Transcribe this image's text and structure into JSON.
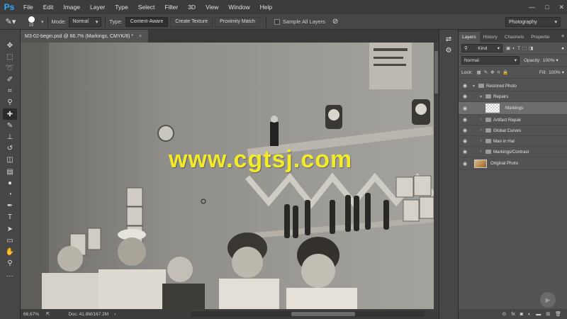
{
  "app": {
    "logo": "Ps"
  },
  "menu": [
    "File",
    "Edit",
    "Image",
    "Layer",
    "Type",
    "Select",
    "Filter",
    "3D",
    "View",
    "Window",
    "Help"
  ],
  "window_controls": {
    "minimize": "—",
    "maximize": "□",
    "close": "✕"
  },
  "options": {
    "brush_size": "19",
    "mode_label": "Mode:",
    "mode_value": "Normal",
    "type_label": "Type:",
    "type_buttons": [
      "Content-Aware",
      "Create Texture",
      "Proximity Match"
    ],
    "sample_all_layers": "Sample All Layers",
    "workspace": "Photography"
  },
  "document": {
    "tab_title": "M3-02-begin.psd @ 66.7% (Markings, CMYK/8) *",
    "close": "×"
  },
  "status": {
    "zoom": "66.67%",
    "doc_size": "Doc: 41.8M/167.2M"
  },
  "panel_tabs": [
    "Layers",
    "History",
    "Channels",
    "Propertie"
  ],
  "layers_panel": {
    "filter_label": "Kind",
    "blend_mode": "Normal",
    "opacity_label": "Opacity:",
    "opacity_value": "100%",
    "lock_label": "Lock:",
    "fill_label": "Fill:",
    "fill_value": "100%",
    "layers": [
      {
        "name": "Restored Photo",
        "kind": "group",
        "indent": 0
      },
      {
        "name": "Repairs",
        "kind": "group",
        "indent": 1
      },
      {
        "name": "Markings",
        "kind": "layer",
        "indent": 2,
        "selected": true
      },
      {
        "name": "Artifact Repair",
        "kind": "group",
        "indent": 1
      },
      {
        "name": "Global Curves",
        "kind": "group",
        "indent": 1
      },
      {
        "name": "Man in Hat",
        "kind": "group",
        "indent": 1
      },
      {
        "name": "Markings/Contrast",
        "kind": "group",
        "indent": 1
      },
      {
        "name": "Original Photo",
        "kind": "photo",
        "indent": 0
      }
    ]
  },
  "watermark": "www.cgtsj.com",
  "colors": {
    "accent": "#31a8ff",
    "watermark": "#f2ea2a"
  }
}
